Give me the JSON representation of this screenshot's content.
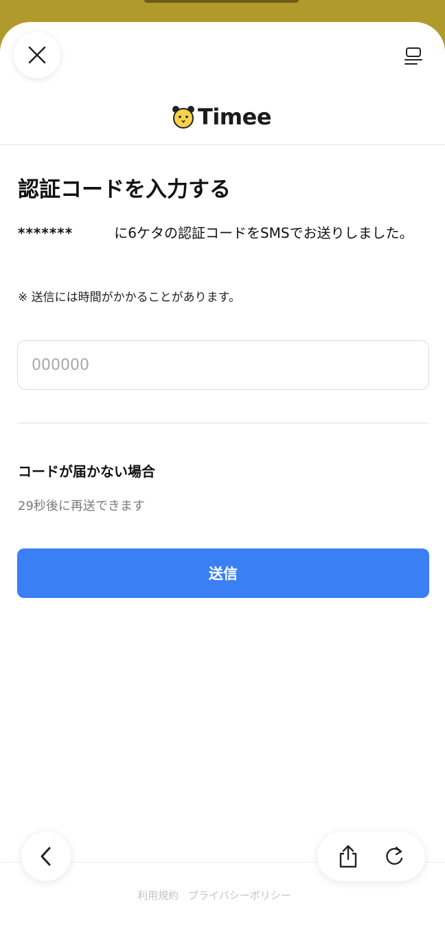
{
  "brand": {
    "name": "Timee"
  },
  "page": {
    "title": "認証コードを入力する",
    "description_mask": "*******",
    "description_text": "に6ケタの認証コードをSMSでお送りしました。",
    "note": "※ 送信には時間がかかることがあります。"
  },
  "code_input": {
    "placeholder": "000000",
    "value": ""
  },
  "no_code": {
    "title": "コードが届かない場合",
    "resend_text": "29秒後に再送できます"
  },
  "submit": {
    "label": "送信"
  },
  "footer": {
    "terms": "利用規約",
    "privacy": "プライバシーポリシー"
  },
  "colors": {
    "primary": "#3a7ff3",
    "backdrop": "#b09a2c",
    "mascot": "#f7d24a"
  },
  "icons": {
    "close": "close-icon",
    "menu": "menu-icon",
    "back": "chevron-left-icon",
    "share": "share-icon",
    "reload": "reload-icon",
    "mascot": "mascot-icon"
  }
}
